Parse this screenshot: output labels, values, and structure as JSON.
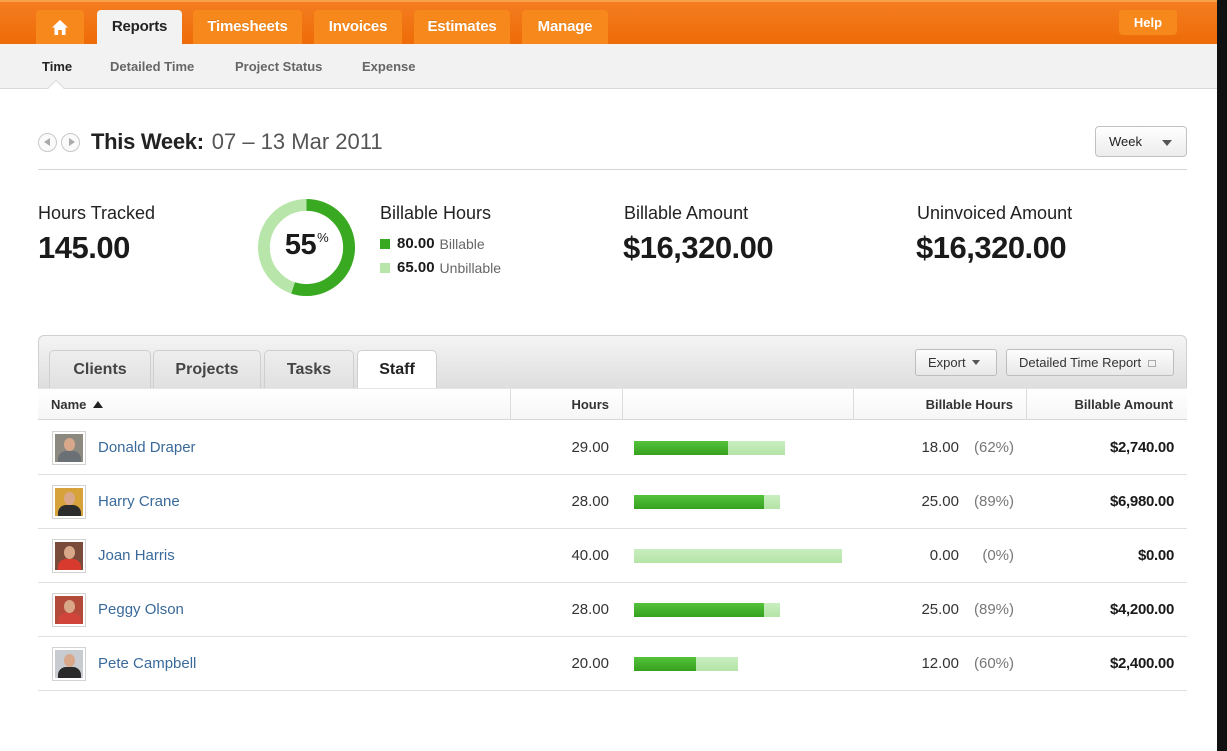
{
  "top_nav": {
    "home_icon": "house-icon",
    "tabs": [
      {
        "label": "Reports",
        "active": true
      },
      {
        "label": "Timesheets",
        "active": false
      },
      {
        "label": "Invoices",
        "active": false
      },
      {
        "label": "Estimates",
        "active": false
      },
      {
        "label": "Manage",
        "active": false
      }
    ],
    "help_label": "Help"
  },
  "sub_nav": {
    "items": [
      {
        "label": "Time",
        "active": true
      },
      {
        "label": "Detailed Time",
        "active": false
      },
      {
        "label": "Project Status",
        "active": false
      },
      {
        "label": "Expense",
        "active": false
      }
    ]
  },
  "period": {
    "prev_icon": "circle-arrow-left-icon",
    "next_icon": "circle-arrow-right-icon",
    "label": "This Week:",
    "range": "07 – 13 Mar 2011",
    "selector_value": "Week"
  },
  "stats": {
    "hours_tracked": {
      "label": "Hours Tracked",
      "value": "145.00"
    },
    "billable_hours": {
      "label": "Billable Hours",
      "percent": "55",
      "percent_sign": "%",
      "billable_fraction": 0.55,
      "billable": {
        "value": "80.00",
        "label": "Billable"
      },
      "unbillable": {
        "value": "65.00",
        "label": "Unbillable"
      }
    },
    "billable_amount": {
      "label": "Billable Amount",
      "value": "$16,320.00"
    },
    "uninvoiced_amount": {
      "label": "Uninvoiced Amount",
      "value": "$16,320.00"
    }
  },
  "colors": {
    "brand_orange": "#f47d20",
    "billable_green": "#3aa922",
    "unbillable_green": "#b8e6aa",
    "link_blue": "#3a6a9a"
  },
  "report": {
    "tabs": [
      {
        "label": "Clients",
        "active": false
      },
      {
        "label": "Projects",
        "active": false
      },
      {
        "label": "Tasks",
        "active": false
      },
      {
        "label": "Staff",
        "active": true
      }
    ],
    "export_label": "Export",
    "detailed_report_label": "Detailed Time Report",
    "columns": {
      "name": "Name",
      "hours": "Hours",
      "billable_hours": "Billable Hours",
      "billable_amount": "Billable Amount"
    },
    "bar_scale_max_hours": 40,
    "rows": [
      {
        "name": "Donald Draper",
        "hours": "29.00",
        "hours_num": 29,
        "billable_hours": "18.00",
        "billable_num": 18,
        "billable_pct": "(62%)",
        "amount": "$2,740.00"
      },
      {
        "name": "Harry Crane",
        "hours": "28.00",
        "hours_num": 28,
        "billable_hours": "25.00",
        "billable_num": 25,
        "billable_pct": "(89%)",
        "amount": "$6,980.00"
      },
      {
        "name": "Joan Harris",
        "hours": "40.00",
        "hours_num": 40,
        "billable_hours": "0.00",
        "billable_num": 0,
        "billable_pct": "(0%)",
        "amount": "$0.00"
      },
      {
        "name": "Peggy Olson",
        "hours": "28.00",
        "hours_num": 28,
        "billable_hours": "25.00",
        "billable_num": 25,
        "billable_pct": "(89%)",
        "amount": "$4,200.00"
      },
      {
        "name": "Pete Campbell",
        "hours": "20.00",
        "hours_num": 20,
        "billable_hours": "12.00",
        "billable_num": 12,
        "billable_pct": "(60%)",
        "amount": "$2,400.00"
      }
    ]
  }
}
